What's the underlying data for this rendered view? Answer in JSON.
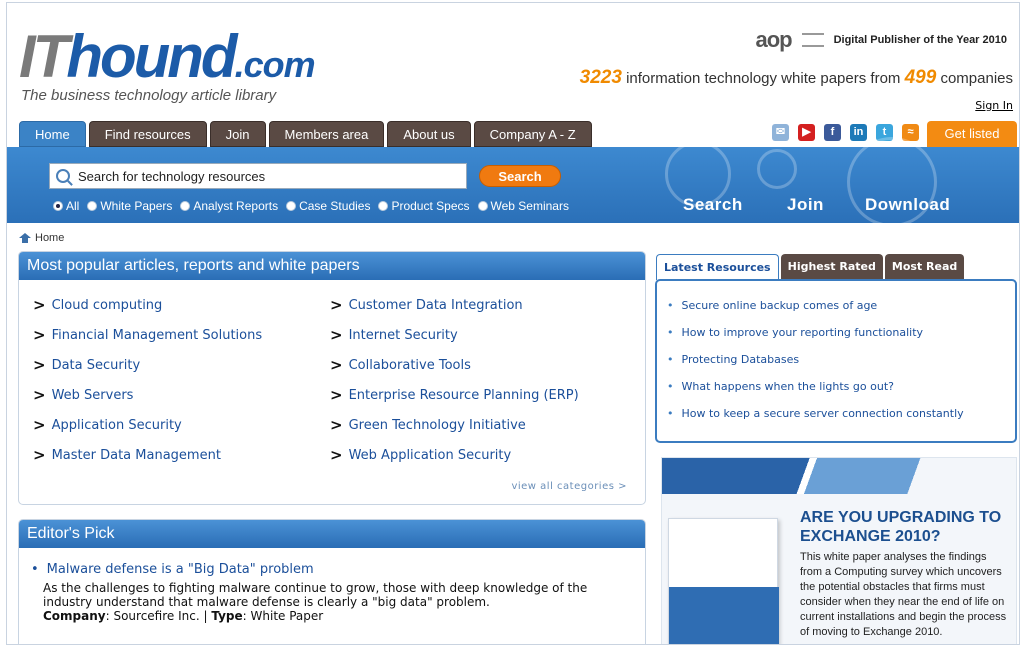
{
  "header": {
    "logo": {
      "it": "IT",
      "hound": "hound",
      "dotcom": ".com",
      "tagline": "The business technology article library"
    },
    "aop_logo": "aop",
    "award": "Digital Publisher of the Year 2010",
    "stats": {
      "papers": "3223",
      "middle": "information technology white papers from",
      "companies": "499",
      "end": "companies"
    },
    "sign_in": "Sign In"
  },
  "nav": {
    "tabs": [
      {
        "label": "Home",
        "active": true
      },
      {
        "label": "Find resources"
      },
      {
        "label": "Join"
      },
      {
        "label": "Members area"
      },
      {
        "label": "About us"
      },
      {
        "label": "Company A - Z"
      }
    ],
    "get_listed": "Get listed",
    "social_icons": [
      "email-icon",
      "youtube-icon",
      "facebook-icon",
      "linkedin-icon",
      "twitter-icon",
      "rss-icon"
    ]
  },
  "search": {
    "value": "Search for technology resources",
    "button": "Search",
    "options": [
      "All",
      "White Papers",
      "Analyst Reports",
      "Case Studies",
      "Product Specs",
      "Web Seminars"
    ],
    "selected": "All",
    "band_words": [
      "Search",
      "Join",
      "Download"
    ]
  },
  "breadcrumb": {
    "home": "Home"
  },
  "popular": {
    "title": "Most popular articles, reports and white papers",
    "left": [
      "Cloud computing",
      "Financial Management Solutions",
      "Data Security",
      "Web Servers",
      "Application Security",
      "Master Data Management"
    ],
    "right": [
      "Customer Data Integration",
      "Internet Security",
      "Collaborative Tools",
      "Enterprise Resource Planning (ERP)",
      "Green Technology Initiative",
      "Web Application Security"
    ],
    "view_all": "view all categories >"
  },
  "editor": {
    "title": "Editor's Pick",
    "item": {
      "title": "Malware defense is a \"Big Data\" problem",
      "desc": "As the challenges to fighting malware continue to grow, those with deep knowledge of the industry understand that malware defense is clearly a \"big data\" problem.",
      "company_label": "Company",
      "company": "Sourcefire Inc.",
      "type_label": "Type",
      "type": "White Paper"
    }
  },
  "resources": {
    "tabs": [
      "Latest Resources",
      "Highest Rated",
      "Most Read"
    ],
    "items": [
      "Secure online backup comes of age",
      "How to improve your reporting functionality",
      "Protecting Databases",
      "What happens when the lights go out?",
      "How to keep a secure server connection constantly"
    ]
  },
  "ad": {
    "headline": "ARE YOU UPGRADING TO EXCHANGE 2010?",
    "body": "This white paper analyses the findings from a Computing survey which uncovers the potential obstacles that firms must consider when they near the end of life on current installations and begin the process of moving to Exchange 2010."
  }
}
